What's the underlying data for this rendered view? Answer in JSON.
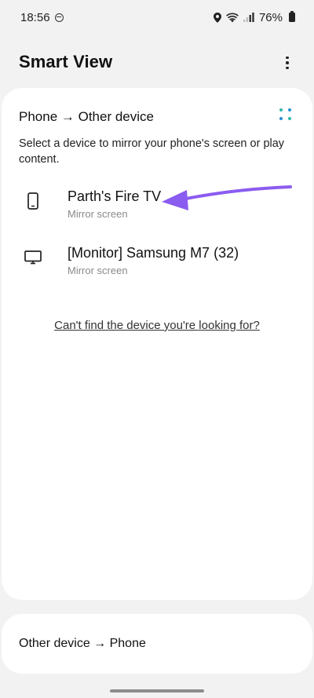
{
  "status_bar": {
    "time": "18:56",
    "battery": "76%"
  },
  "header": {
    "title": "Smart View"
  },
  "main_card": {
    "section_title": "Phone → Other device",
    "description": "Select a device to mirror your phone's screen or play content.",
    "devices": [
      {
        "name": "Parth's Fire TV",
        "subtitle": "Mirror screen",
        "icon": "phone-icon"
      },
      {
        "name": "[Monitor] Samsung M7 (32)",
        "subtitle": "Mirror screen",
        "icon": "monitor-icon"
      }
    ],
    "help_link": "Can't find the device you're looking for?",
    "annotation_color": "#8b5cf0"
  },
  "other_card": {
    "section_title": "Other device → Phone"
  },
  "colors": {
    "background": "#f2f2f2",
    "card": "#ffffff",
    "accent_blue": "#2b8fd6",
    "accent_teal": "#2fb6a8",
    "subtitle": "#8a8a8a"
  }
}
